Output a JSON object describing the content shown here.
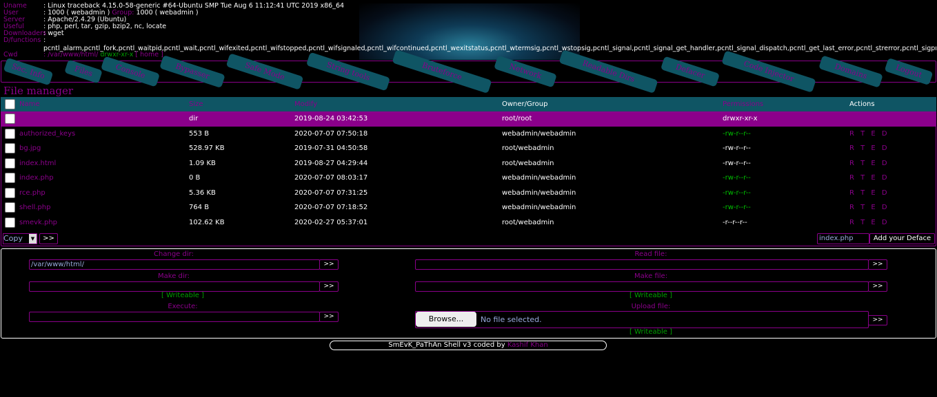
{
  "sysinfo": {
    "uname_label": "Uname",
    "uname_value": ": Linux traceback 4.15.0-58-generic #64-Ubuntu SMP Tue Aug 6 11:12:41 UTC 2019 x86_64",
    "user_label": "User",
    "user_value": ": 1000 ( webadmin )",
    "group_label": "Group:",
    "group_value": "1000 ( webadmin )",
    "server_label": "Server",
    "server_value": ": Apache/2.4.29 (Ubuntu)",
    "useful_label": "Useful",
    "useful_value": ": php, perl, tar, gzip, bzip2, nc, locate",
    "downloaders_label": "Downloaders",
    "downloaders_value": ": wget",
    "dfunctions_label": "D/functions",
    "dfunctions_value": ":",
    "functions_list": "pcntl_alarm,pcntl_fork,pcntl_waitpid,pcntl_wait,pcntl_wifexited,pcntl_wifstopped,pcntl_wifsignaled,pcntl_wifcontinued,pcntl_wexitstatus,pcntl_wtermsig,pcntl_wstopsig,pcntl_signal,pcntl_signal_get_handler,pcntl_signal_dispatch,pcntl_get_last_error,pcntl_strerror,pcntl_sigprocmask,pcntl_sigwaitinfo",
    "cwd_label": "Cwd",
    "cwd_path": ": /var/www/html/",
    "cwd_perm": "drwxr-xr-x",
    "cwd_home": "[ home ]"
  },
  "nav": {
    "tabs": [
      "Sec. Info",
      "Files",
      "Console",
      "Bypasser",
      "Safe Mode",
      "String tools",
      "Bruteforce",
      "Network",
      "Readable Dirs",
      "Defacer",
      "Code Injector",
      "Domains",
      "Logout"
    ]
  },
  "file_manager": {
    "title": "File manager",
    "headers": [
      "Name",
      "Size",
      "Modify",
      "Owner/Group",
      "Permissions",
      "Actions"
    ],
    "rows": [
      {
        "name": "",
        "size": "dir",
        "modify": "2019-08-24 03:42:53",
        "owner": "root/root",
        "perm": "drwxr-xr-x",
        "actions": ""
      },
      {
        "name": "authorized_keys",
        "size": "553 B",
        "modify": "2020-07-07 07:50:18",
        "owner": "webadmin/webadmin",
        "perm": "-rw-r--r--",
        "actions": "R T E D"
      },
      {
        "name": "bg.jpg",
        "size": "528.97 KB",
        "modify": "2019-07-31 04:50:58",
        "owner": "root/webadmin",
        "perm": "-rw-r--r--",
        "actions": "R T E D"
      },
      {
        "name": "index.html",
        "size": "1.09 KB",
        "modify": "2019-08-27 04:29:44",
        "owner": "root/webadmin",
        "perm": "-rw-r--r--",
        "actions": "R T E D"
      },
      {
        "name": "index.php",
        "size": "0 B",
        "modify": "2020-07-07 08:03:17",
        "owner": "webadmin/webadmin",
        "perm": "-rw-r--r--",
        "actions": "R T E D"
      },
      {
        "name": "rce.php",
        "size": "5.36 KB",
        "modify": "2020-07-07 07:31:25",
        "owner": "webadmin/webadmin",
        "perm": "-rw-r--r--",
        "actions": "R T E D"
      },
      {
        "name": "shell.php",
        "size": "764 B",
        "modify": "2020-07-07 07:18:52",
        "owner": "webadmin/webadmin",
        "perm": "-rw-r--r--",
        "actions": "R T E D"
      },
      {
        "name": "smevk.php",
        "size": "102.62 KB",
        "modify": "2020-02-27 05:37:01",
        "owner": "root/webadmin",
        "perm": "-r--r--r--",
        "actions": "R T E D"
      }
    ],
    "copy_select": "Copy",
    "go_button": ">>",
    "deface_input": "index.php",
    "deface_button": "Add your Deface"
  },
  "tools": {
    "change_dir_label": "Change dir:",
    "change_dir_value": "/var/www/html/",
    "make_dir_label": "Make dir:",
    "writeable_1": "[ Writeable ]",
    "execute_label": "Execute:",
    "read_file_label": "Read file:",
    "make_file_label": "Make file:",
    "writeable_2": "[ Writeable ]",
    "upload_file_label": "Upload file:",
    "browse_label": "Browse...",
    "no_file_text": "No file selected.",
    "writeable_3": "[ Writeable ]",
    "go": ">>"
  },
  "footer": {
    "text": "SmEvK_PaThAn Shell v3 coded by",
    "author": "Kashif Khan"
  },
  "colors": {
    "accent": "#8b008b",
    "tab_bg": "#0f5564",
    "ok": "#00a000"
  }
}
